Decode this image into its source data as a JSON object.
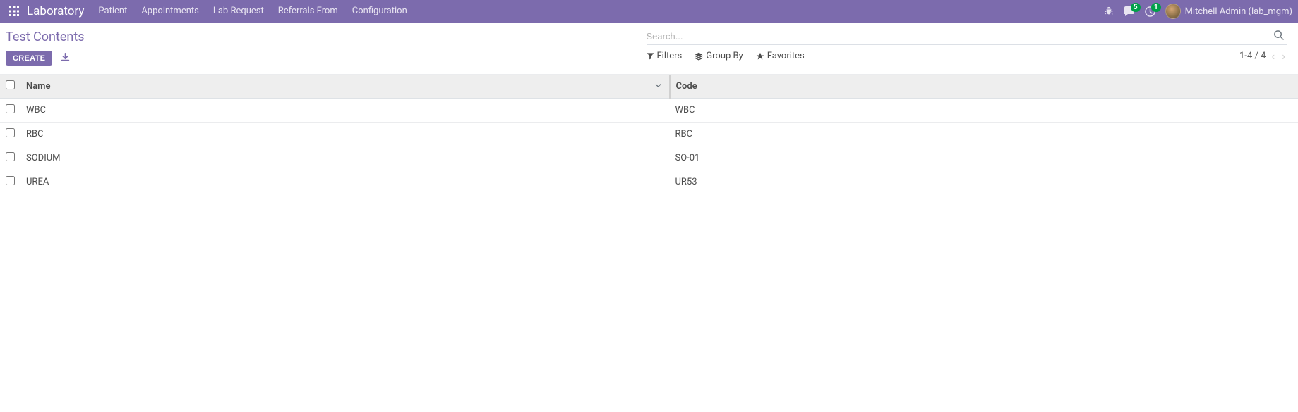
{
  "navbar": {
    "brand": "Laboratory",
    "links": [
      "Patient",
      "Appointments",
      "Lab Request",
      "Referrals From",
      "Configuration"
    ],
    "messages_badge": "5",
    "activities_badge": "1",
    "user_label": "Mitchell Admin (lab_mgm)"
  },
  "breadcrumb": "Test Contents",
  "buttons": {
    "create": "CREATE"
  },
  "search": {
    "placeholder": "Search..."
  },
  "filters": {
    "filters": "Filters",
    "groupby": "Group By",
    "favorites": "Favorites"
  },
  "pager": {
    "text": "1-4 / 4"
  },
  "table": {
    "headers": {
      "name": "Name",
      "code": "Code"
    },
    "rows": [
      {
        "name": "WBC",
        "code": "WBC"
      },
      {
        "name": "RBC",
        "code": "RBC"
      },
      {
        "name": "SODIUM",
        "code": "SO-01"
      },
      {
        "name": "UREA",
        "code": "UR53"
      }
    ]
  }
}
